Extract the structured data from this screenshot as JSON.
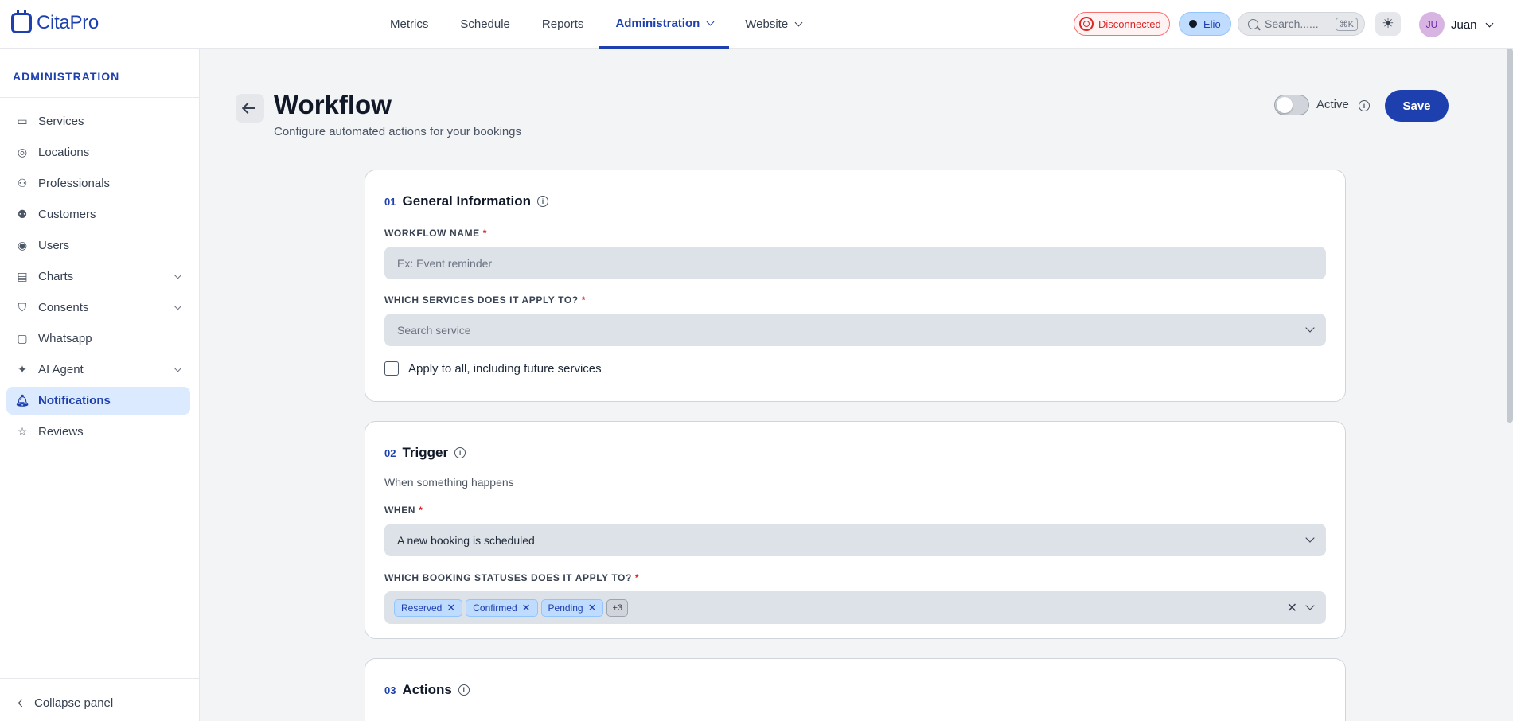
{
  "app": {
    "brand": "CitaPro"
  },
  "nav": {
    "items": [
      {
        "label": "Metrics"
      },
      {
        "label": "Schedule"
      },
      {
        "label": "Reports"
      },
      {
        "label": "Administration"
      },
      {
        "label": "Website"
      }
    ]
  },
  "topbar": {
    "status_label": "Disconnected",
    "assistant_label": "Elio",
    "search_placeholder": "Search......",
    "search_shortcut": "⌘K",
    "user_initials": "JU",
    "user_name": "Juan"
  },
  "sidebar": {
    "title": "ADMINISTRATION",
    "items": [
      {
        "label": "Services",
        "icon": "box-icon"
      },
      {
        "label": "Locations",
        "icon": "map-pin-icon"
      },
      {
        "label": "Professionals",
        "icon": "users-icon"
      },
      {
        "label": "Customers",
        "icon": "customers-icon"
      },
      {
        "label": "Users",
        "icon": "user-circle-icon"
      },
      {
        "label": "Charts",
        "icon": "clipboard-icon"
      },
      {
        "label": "Consents",
        "icon": "shield-check-icon"
      },
      {
        "label": "Whatsapp",
        "icon": "chat-icon"
      },
      {
        "label": "AI Agent",
        "icon": "sparkles-icon"
      },
      {
        "label": "Notifications",
        "icon": "bell-icon"
      },
      {
        "label": "Reviews",
        "icon": "star-icon"
      }
    ],
    "collapse_label": "Collapse panel"
  },
  "page": {
    "title": "Workflow",
    "subtitle": "Configure automated actions for your bookings",
    "toggle_label": "Active",
    "save_label": "Save"
  },
  "sections": {
    "general": {
      "num": "01",
      "title": "General Information",
      "name_label": "WORKFLOW NAME",
      "name_placeholder": "Ex: Event reminder",
      "services_label": "WHICH SERVICES DOES IT APPLY TO?",
      "services_placeholder": "Search service",
      "apply_all_label": "Apply to all, including future services"
    },
    "trigger": {
      "num": "02",
      "title": "Trigger",
      "description": "When something happens",
      "when_label": "WHEN",
      "when_value": "A new booking is scheduled",
      "statuses_label": "WHICH BOOKING STATUSES DOES IT APPLY TO?",
      "statuses": [
        "Reserved",
        "Confirmed",
        "Pending"
      ],
      "statuses_more": "+3"
    },
    "actions": {
      "num": "03",
      "title": "Actions"
    }
  },
  "colors": {
    "accent": "#1e40af",
    "danger": "#dc2626",
    "active_bg": "#dbeafe"
  }
}
